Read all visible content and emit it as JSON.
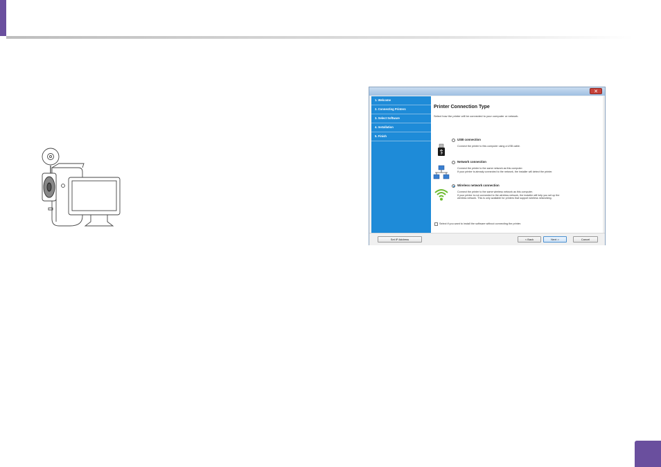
{
  "dialog": {
    "close_label": "✕",
    "steps": [
      {
        "label": "1. Welcome"
      },
      {
        "label": "2. Connecting Printers"
      },
      {
        "label": "3. Select Software"
      },
      {
        "label": "4. Installation"
      },
      {
        "label": "5. Finish"
      }
    ],
    "title": "Printer Connection Type",
    "subtitle": "Select how the printer will be connected to your computer or network.",
    "options": [
      {
        "label": "USB connection",
        "selected": false,
        "desc_lines": [
          "Connect the printer to this computer using a USB cable."
        ]
      },
      {
        "label": "Network connection",
        "selected": false,
        "desc_lines": [
          "Connect the printer to the same network as this computer.",
          "If your printer is already connected to the network, the installer will detect the printer."
        ]
      },
      {
        "label": "Wireless network connection",
        "selected": true,
        "desc_lines": [
          "Connect the printer to the same wireless network as this computer.",
          "If your printer is not connected to the wireless network, the installer will help you set up the",
          "wireless network. This is only available for printers that support wireless networking."
        ]
      }
    ],
    "checkbox_label": "Select if you want to install the software without connecting the printer.",
    "buttons": {
      "set_ip": "Set IP Address",
      "back": "< Back",
      "next": "Next >",
      "cancel": "Cancel"
    }
  },
  "colors": {
    "accent": "#6a4f9e",
    "sidebar": "#1e8bd8"
  }
}
